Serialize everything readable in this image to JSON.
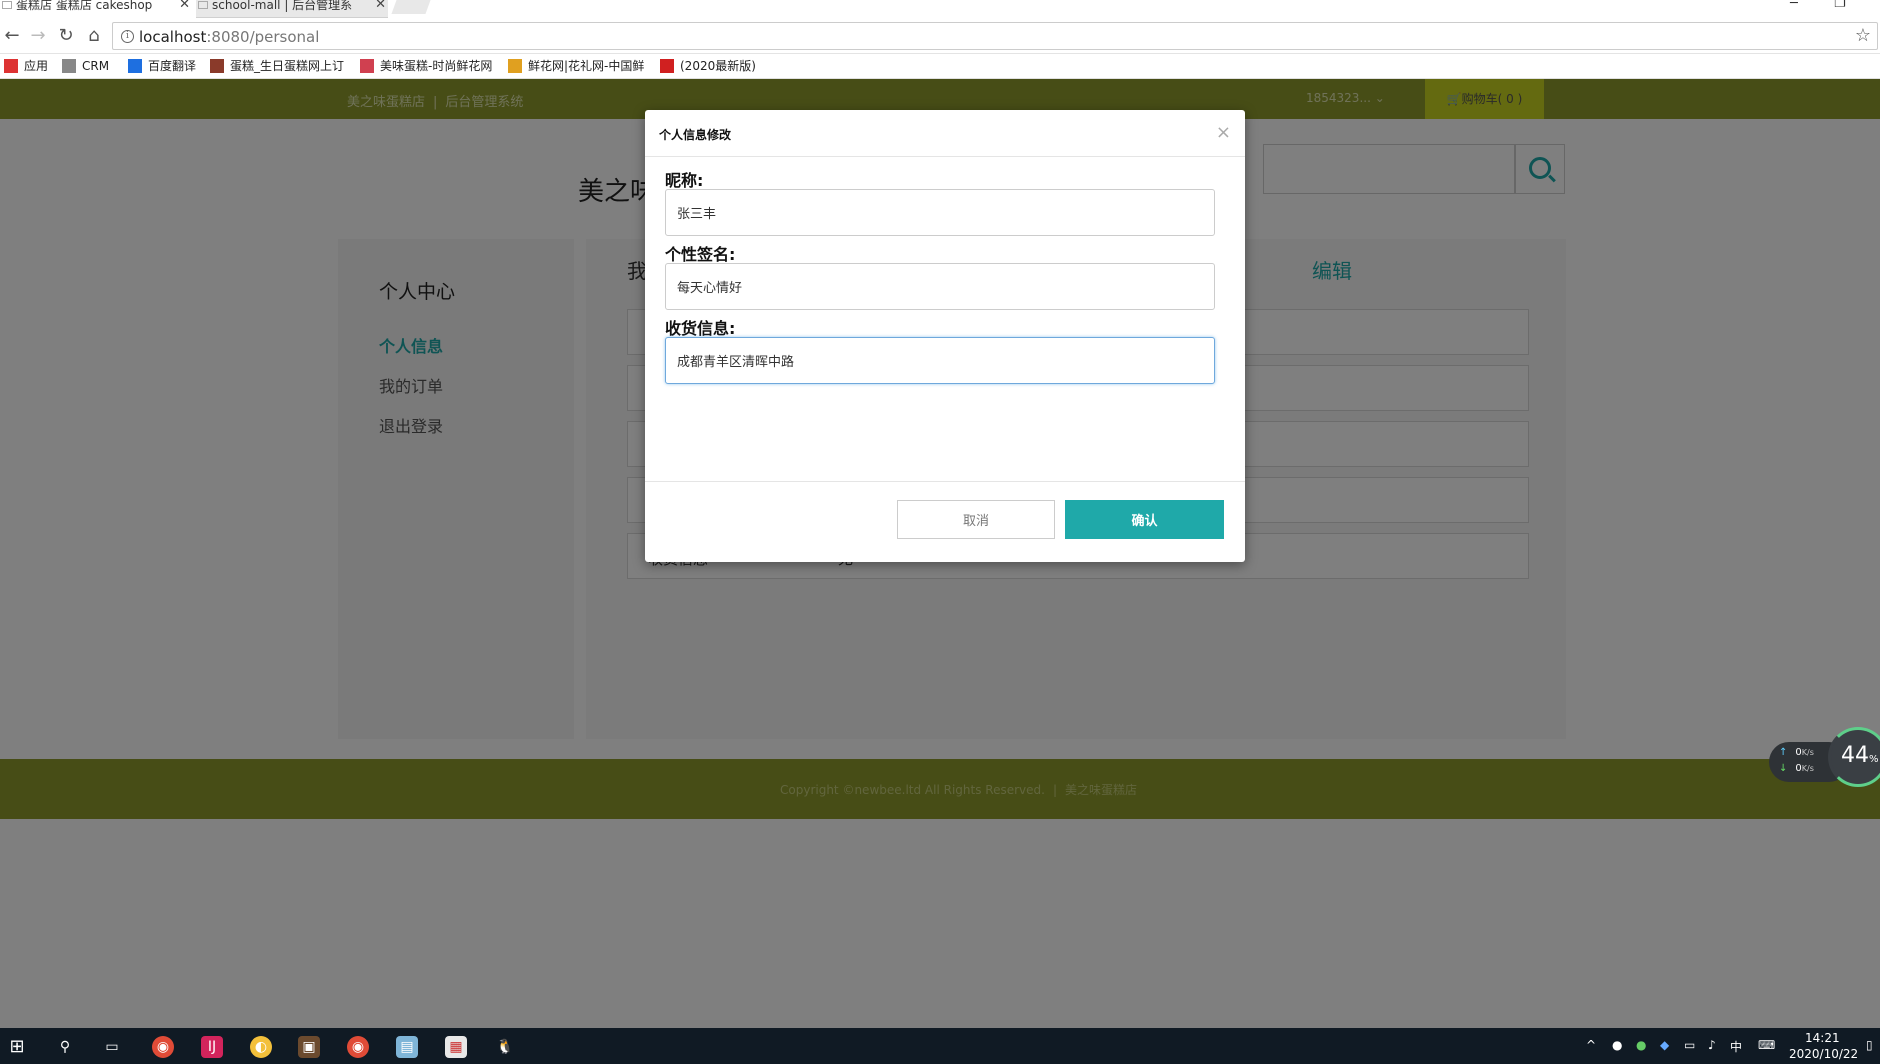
{
  "browser": {
    "tabs": [
      {
        "title": "蛋糕店 蛋糕店 cakeshop",
        "close": "✕"
      },
      {
        "title": "school-mall | 后台管理系",
        "close": "✕"
      }
    ],
    "window_controls": {
      "minimize": "─",
      "restore": "❐"
    },
    "nav": {
      "back": "←",
      "forward": "→",
      "reload": "↻",
      "home": "⌂"
    },
    "url_host": "localhost",
    "url_path": ":8080/personal",
    "bookmarks": [
      {
        "label": "应用",
        "icon": "apps-grid-icon",
        "color": "#d33"
      },
      {
        "label": "CRM",
        "icon": "page-icon",
        "color": "#888"
      },
      {
        "label": "百度翻译",
        "icon": "translate-icon",
        "color": "#1e6fe0"
      },
      {
        "label": "蛋糕_生日蛋糕网上订",
        "icon": "cake-site-icon",
        "color": "#8a3a2a"
      },
      {
        "label": "美味蛋糕-时尚鲜花网",
        "icon": "flower-icon",
        "color": "#d04050"
      },
      {
        "label": "鲜花网|花礼网-中国鲜",
        "icon": "star-flower-icon",
        "color": "#e0a020"
      },
      {
        "label": "(2020最新版)",
        "icon": "c-logo-icon",
        "color": "#d02020"
      }
    ]
  },
  "site": {
    "header_title": "美之味蛋糕店",
    "header_subtitle": "后台管理系统",
    "header_sep": "|",
    "user": "1854323...",
    "cart_label": "购物车( 0 )",
    "brand": "美之味",
    "sidebar": {
      "title": "个人中心",
      "items": [
        "个人信息",
        "我的订单",
        "退出登录"
      ]
    },
    "main": {
      "title": "我",
      "edit": "编辑",
      "last_row_key": "收货信息",
      "last_row_value": "无"
    },
    "footer": {
      "copyright": "Copyright ©newbee.ltd All Rights Reserved.",
      "sep": "|",
      "shop": "美之味蛋糕店"
    }
  },
  "modal": {
    "title": "个人信息修改",
    "close": "×",
    "fields": [
      {
        "label": "昵称:",
        "value": "张三丰"
      },
      {
        "label": "个性签名:",
        "value": "每天心情好"
      },
      {
        "label": "收货信息:",
        "value": "成都青羊区清晖中路"
      }
    ],
    "cancel": "取消",
    "confirm": "确认",
    "accent": "#1fa9a9"
  },
  "netmon": {
    "up_speed": "0",
    "down_speed": "0",
    "unit": "K/s",
    "percent": "44",
    "percent_sign": "%"
  },
  "taskbar": {
    "tray_lang": "中",
    "time": "14:21",
    "date": "2020/10/22"
  }
}
